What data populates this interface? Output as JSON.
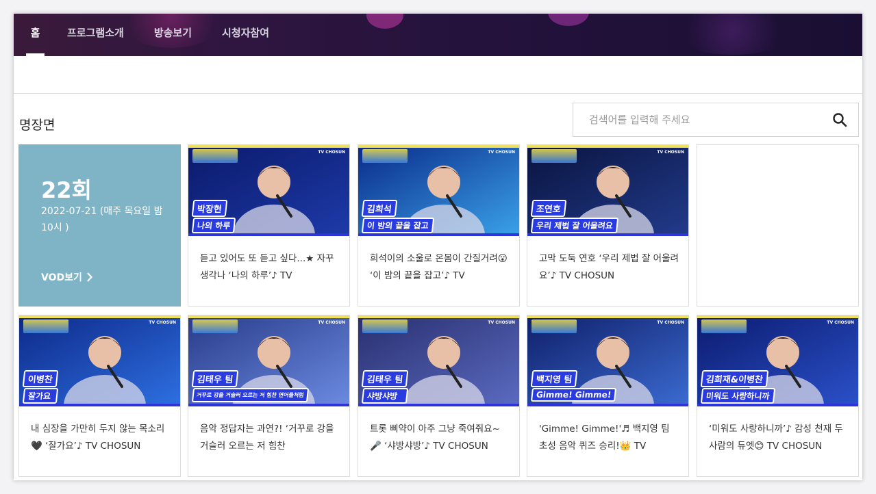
{
  "nav": {
    "items": [
      {
        "label": "홈",
        "active": true
      },
      {
        "label": "프로그램소개",
        "active": false
      },
      {
        "label": "방송보기",
        "active": false
      },
      {
        "label": "시청자참여",
        "active": false
      }
    ]
  },
  "section": {
    "title": "명장면"
  },
  "search": {
    "placeholder": "검색어를 입력해 주세요",
    "value": ""
  },
  "episode": {
    "number": "22회",
    "date": "2022-07-21 (매주 목요일 밤 10시 )",
    "vod_label": "VOD보기",
    "bg_color": "#7fb3c6"
  },
  "tv_logo": "TV CHOSUN",
  "clips": [
    {
      "name_tag": "박장현",
      "song_tag": "나의 하루",
      "caption": "듣고 있어도 또 듣고 싶다...★ 자꾸 생각나 ‘나의 하루’♪ TV",
      "bg": [
        "#0b1a6b",
        "#1d3aa8"
      ]
    },
    {
      "name_tag": "김희석",
      "song_tag": "이 밤의 끝을 잡고",
      "caption": "희석이의 소울로 온몸이 간질거려😮 ‘이 밤의 끝을 잡고’♪ TV",
      "bg": [
        "#0a2c8a",
        "#3aa0e8"
      ]
    },
    {
      "name_tag": "조연호",
      "song_tag": "우리 제법 잘 어울려요",
      "caption": "고막 도둑 연호 ‘우리 제법 잘 어울려요’♪ TV CHOSUN",
      "bg": [
        "#0a1440",
        "#213a8a"
      ]
    },
    {
      "name_tag": "",
      "song_tag": "",
      "caption": "",
      "bg": [
        "#ffffff",
        "#ffffff"
      ]
    },
    {
      "name_tag": "이병찬",
      "song_tag": "잘가요",
      "caption": "내 심장을 가만히 두지 않는 목소리🖤 ‘잘가요’♪ TV CHOSUN",
      "bg": [
        "#0e2a8a",
        "#2d6fe0"
      ]
    },
    {
      "name_tag": "김태우 팀",
      "song_tag": "거꾸로 강을 거슬러 오르는 저 힘찬 연어들처럼",
      "caption": "음악 정답자는 과연?! ‘거꾸로 강을 거슬러 오르는 저 힘찬",
      "bg": [
        "#2a3c8a",
        "#6a8ae0"
      ]
    },
    {
      "name_tag": "김태우 팀",
      "song_tag": "샤방샤방",
      "caption": "트롯 삐약이 아주 그냥 죽여줘요~🎤 ‘샤방샤방’♪ TV CHOSUN",
      "bg": [
        "#2a3070",
        "#5a6ac0"
      ]
    },
    {
      "name_tag": "백지영 팀",
      "song_tag": "Gimme! Gimme!",
      "caption": "'Gimme! Gimme!'♬ 백지영 팀 초성 음악 퀴즈 승리!👑 TV",
      "bg": [
        "#10206a",
        "#3a6ad0"
      ]
    },
    {
      "name_tag": "김희재&이병찬",
      "song_tag": "미워도 사랑하니까",
      "caption": "‘미워도 사랑하니까’♪ 감성 천재 두 사람의 듀엣😊 TV CHOSUN",
      "bg": [
        "#0c1c70",
        "#2a50c8"
      ]
    }
  ]
}
